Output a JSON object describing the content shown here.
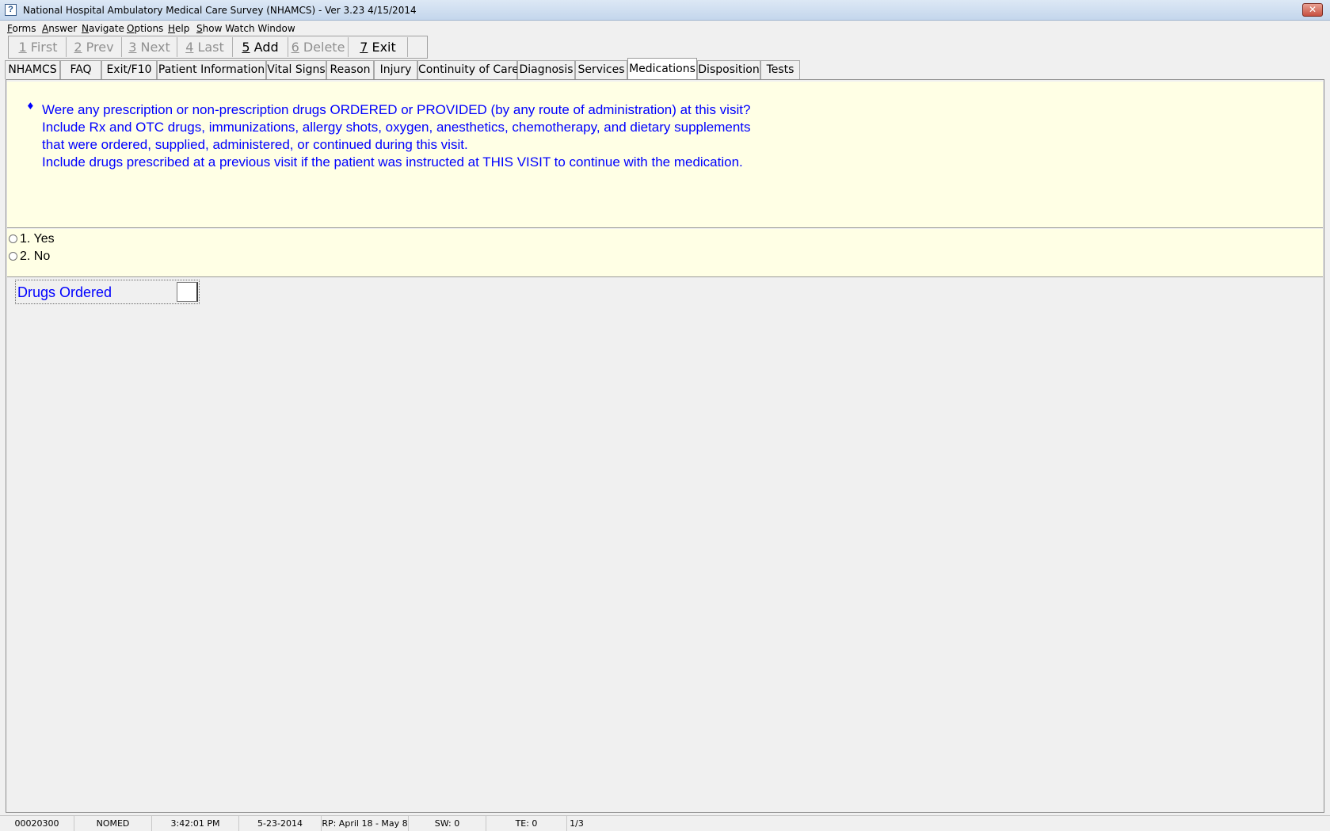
{
  "window": {
    "title": "National Hospital Ambulatory Medical Care Survey (NHAMCS) - Ver 3.23 4/15/2014",
    "close_glyph": "✕"
  },
  "menu": [
    {
      "hot": "F",
      "rest": "orms"
    },
    {
      "hot": "A",
      "rest": "nswer"
    },
    {
      "hot": "N",
      "rest": "avigate"
    },
    {
      "hot": "O",
      "rest": "ptions"
    },
    {
      "hot": "H",
      "rest": "elp"
    },
    {
      "hot": "S",
      "rest": "how Watch Window"
    }
  ],
  "nav_buttons": [
    {
      "num": "1",
      "label": " First",
      "enabled": false
    },
    {
      "num": "2",
      "label": " Prev",
      "enabled": false
    },
    {
      "num": "3",
      "label": " Next",
      "enabled": false
    },
    {
      "num": "4",
      "label": " Last",
      "enabled": false
    },
    {
      "num": "5",
      "label": " Add",
      "enabled": true
    },
    {
      "num": "6",
      "label": " Delete",
      "enabled": false
    },
    {
      "num": "7",
      "label": " Exit",
      "enabled": true
    }
  ],
  "tabs": [
    {
      "label": "NHAMCS"
    },
    {
      "label": "FAQ"
    },
    {
      "label": "Exit/F10"
    },
    {
      "label": "Patient Information"
    },
    {
      "label": "Vital Signs"
    },
    {
      "label": "Reason"
    },
    {
      "label": "Injury"
    },
    {
      "label": "Continuity of Care"
    },
    {
      "label": "Diagnosis"
    },
    {
      "label": "Services"
    },
    {
      "label": "Medications",
      "active": true
    },
    {
      "label": "Disposition"
    },
    {
      "label": "Tests"
    }
  ],
  "question": {
    "bullet": "♦",
    "lines": [
      "Were any prescription or non-prescription drugs ORDERED or PROVIDED (by any route of administration) at this visit?",
      "Include Rx and OTC drugs, immunizations, allergy shots, oxygen, anesthetics, chemotherapy, and dietary supplements",
      "that were ordered, supplied, administered, or continued during this visit.",
      "Include drugs prescribed at a previous visit if the patient was instructed at THIS VISIT to continue with the medication."
    ]
  },
  "options": [
    {
      "label": "1.  Yes"
    },
    {
      "label": "2.  No"
    }
  ],
  "field": {
    "label": "Drugs Ordered",
    "value": ""
  },
  "status": [
    "00020300",
    "NOMED",
    "3:42:01 PM",
    "5-23-2014",
    "RP: April 18  - May 8",
    "SW: 0",
    "TE: 0",
    "1/3"
  ]
}
